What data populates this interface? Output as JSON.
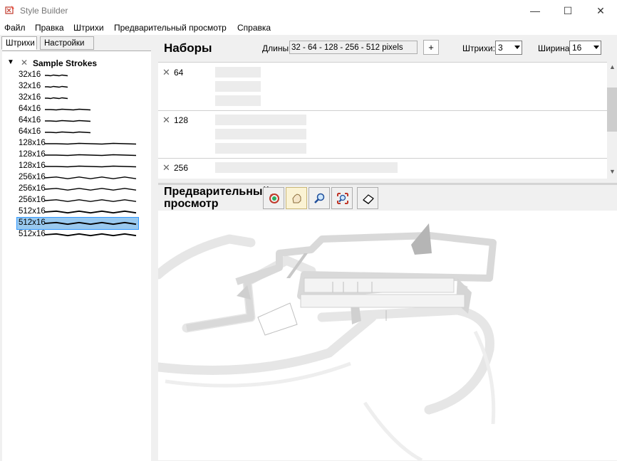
{
  "window": {
    "title": "Style Builder",
    "minimize": "—",
    "maximize": "☐",
    "close": "✕"
  },
  "menu": [
    "Файл",
    "Правка",
    "Штрихи",
    "Предварительный просмотр",
    "Справка"
  ],
  "left_tabs": {
    "strokes": "Штрихи",
    "settings": "Настройки"
  },
  "tree": {
    "toggle": "▼",
    "root": "Sample Strokes",
    "items": [
      {
        "label": "32x16"
      },
      {
        "label": "32x16"
      },
      {
        "label": "32x16"
      },
      {
        "label": "64x16"
      },
      {
        "label": "64x16"
      },
      {
        "label": "64x16"
      },
      {
        "label": "128x16"
      },
      {
        "label": "128x16"
      },
      {
        "label": "128x16"
      },
      {
        "label": "256x16"
      },
      {
        "label": "256x16"
      },
      {
        "label": "256x16"
      },
      {
        "label": "512x16"
      },
      {
        "label": "512x16",
        "selected": true
      },
      {
        "label": "512x16"
      }
    ]
  },
  "sets": {
    "title": "Наборы",
    "lengths_label": "Длины:",
    "lengths_value": "32 - 64 - 128 - 256 - 512 pixels",
    "plus": "+",
    "strokes_label": "Штрихи:",
    "strokes_value": "3",
    "width_label": "Ширина:",
    "width_value": "16",
    "rows": [
      {
        "length": "64"
      },
      {
        "length": "128"
      },
      {
        "length": "256"
      }
    ]
  },
  "preview": {
    "title": "Предварительный просмотр",
    "tools": [
      {
        "name": "orbit-icon",
        "active": false
      },
      {
        "name": "pan-icon",
        "active": true
      },
      {
        "name": "zoom-icon",
        "active": false
      },
      {
        "name": "zoom-extents-icon",
        "active": false
      },
      {
        "name": "eraser-icon",
        "active": false
      }
    ]
  }
}
